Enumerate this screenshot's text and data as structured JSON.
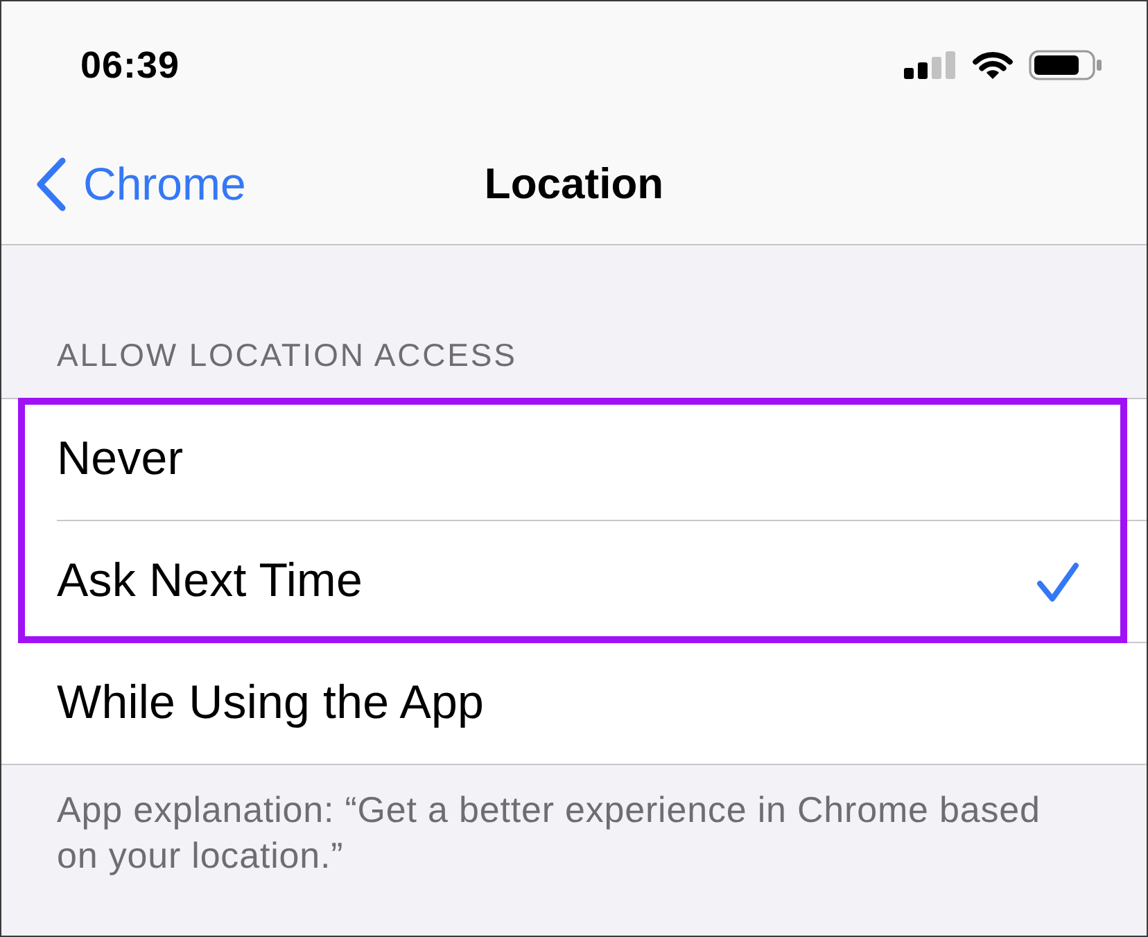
{
  "status_bar": {
    "time": "06:39"
  },
  "nav_bar": {
    "back_label": "Chrome",
    "title": "Location"
  },
  "section": {
    "header": "ALLOW LOCATION ACCESS",
    "options": [
      {
        "label": "Never",
        "selected": false,
        "highlighted": true
      },
      {
        "label": "Ask Next Time",
        "selected": true,
        "highlighted": true
      },
      {
        "label": "While Using the App",
        "selected": false,
        "highlighted": false
      }
    ],
    "footer": "App explanation: “Get a better experience in Chrome based on your location.”"
  }
}
